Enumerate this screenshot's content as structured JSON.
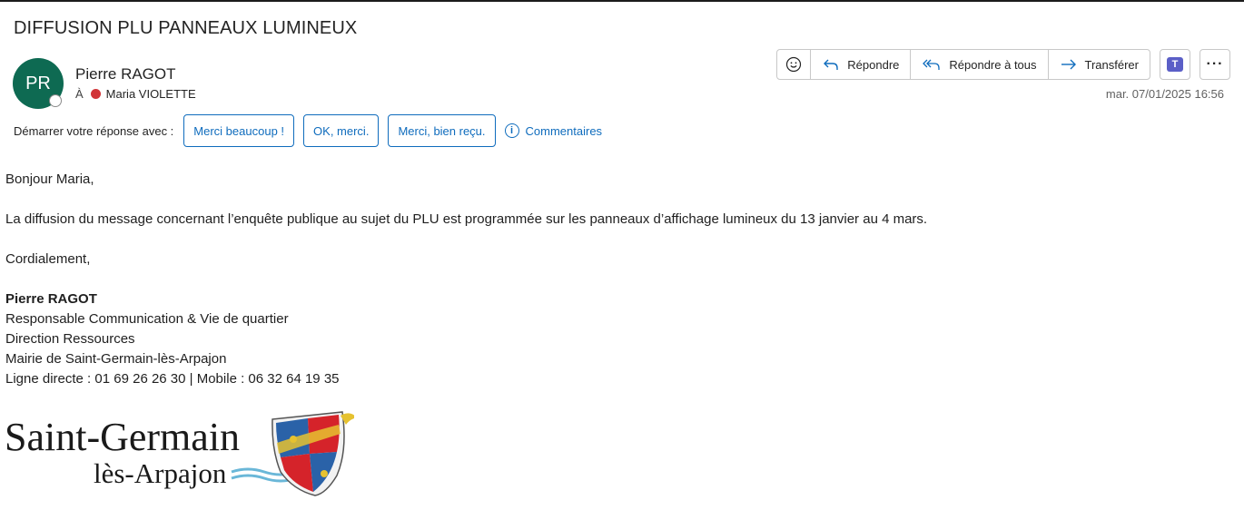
{
  "email": {
    "subject": "DIFFUSION PLU PANNEAUX LUMINEUX",
    "sender": {
      "initials": "PR",
      "name": "Pierre RAGOT",
      "to_label": "À",
      "recipient": "Maria VIOLETTE"
    },
    "date": "mar. 07/01/2025 16:56",
    "actions": {
      "emoji_icon": "smile-icon",
      "reply": "Répondre",
      "reply_all": "Répondre à tous",
      "forward": "Transférer",
      "teams_icon": "teams-icon",
      "more_icon": "more-icon"
    },
    "quick_replies": {
      "label": "Démarrer votre réponse avec :",
      "options": [
        "Merci beaucoup !",
        "OK, merci.",
        "Merci, bien reçu."
      ],
      "feedback": "Commentaires"
    },
    "body": {
      "greeting": "Bonjour Maria,",
      "message": "La diffusion du message concernant l’enquête publique au sujet du PLU est programmée sur les panneaux d’affichage lumineux du 13 janvier au 4 mars.",
      "closing": "Cordialement,"
    },
    "signature": {
      "name": "Pierre RAGOT",
      "title": "Responsable Communication & Vie de quartier",
      "department": "Direction Ressources",
      "organization": "Mairie de Saint-Germain-lès-Arpajon",
      "phones": "Ligne directe : 01 69 26 26 30 | Mobile : 06 32 64 19 35"
    },
    "logo": {
      "line1": "Saint-Germain",
      "line2": "lès-Arpajon"
    }
  },
  "colors": {
    "accent": "#0f6cbd",
    "avatar": "#0e6a52",
    "presence_busy": "#d13438"
  }
}
